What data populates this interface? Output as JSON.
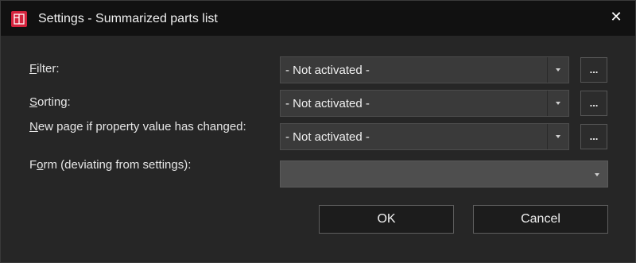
{
  "window": {
    "title": "Settings - Summarized parts list",
    "close_glyph": "✕",
    "icon": "app-icon"
  },
  "rows": [
    {
      "label_underline": "F",
      "label_rest": "ilter:",
      "value": "- Not activated -",
      "dots_label": "..."
    },
    {
      "label_underline": "S",
      "label_rest": "orting:",
      "value": "- Not activated -",
      "dots_label": "..."
    },
    {
      "label_underline": "N",
      "label_rest": "ew page if property value has changed:",
      "value": "- Not activated -",
      "dots_label": "..."
    }
  ],
  "form": {
    "label_before": "F",
    "label_underline": "o",
    "label_rest": "rm (deviating from settings):",
    "value": ""
  },
  "buttons": {
    "ok": "OK",
    "cancel": "Cancel"
  },
  "colors": {
    "accent": "#d4233d",
    "background": "#262626",
    "titlebar": "#111111"
  }
}
